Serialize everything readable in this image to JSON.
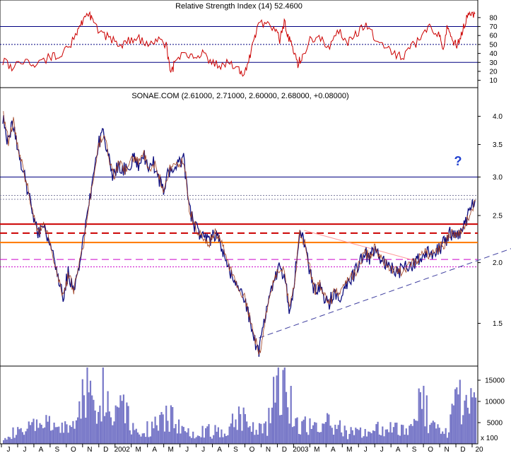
{
  "chart_data": {
    "type": "line",
    "rsi_panel": {
      "title": "Relative Strength Index (14) 52.4600",
      "y_ticks": [
        10,
        20,
        30,
        40,
        50,
        60,
        70,
        80
      ],
      "ylim": [
        5,
        87
      ],
      "levels": {
        "upper": 70,
        "middle": 50,
        "lower": 30
      },
      "line_color": "#cc0000",
      "key_points": [
        {
          "t": 0,
          "v": 32
        },
        {
          "t": 2,
          "v": 25
        },
        {
          "t": 5,
          "v": 34
        },
        {
          "t": 7,
          "v": 28
        },
        {
          "t": 10,
          "v": 35
        },
        {
          "t": 12,
          "v": 38
        },
        {
          "t": 14,
          "v": 45
        },
        {
          "t": 16,
          "v": 58
        },
        {
          "t": 17,
          "v": 72
        },
        {
          "t": 18,
          "v": 80
        },
        {
          "t": 19,
          "v": 86
        },
        {
          "t": 20,
          "v": 72
        },
        {
          "t": 22,
          "v": 62
        },
        {
          "t": 24,
          "v": 55
        },
        {
          "t": 26,
          "v": 50
        },
        {
          "t": 28,
          "v": 54
        },
        {
          "t": 30,
          "v": 56
        },
        {
          "t": 32,
          "v": 50
        },
        {
          "t": 34,
          "v": 56
        },
        {
          "t": 36,
          "v": 48
        },
        {
          "t": 37,
          "v": 15
        },
        {
          "t": 38,
          "v": 32
        },
        {
          "t": 40,
          "v": 40
        },
        {
          "t": 42,
          "v": 35
        },
        {
          "t": 44,
          "v": 42
        },
        {
          "t": 46,
          "v": 30
        },
        {
          "t": 48,
          "v": 26
        },
        {
          "t": 50,
          "v": 30
        },
        {
          "t": 52,
          "v": 22
        },
        {
          "t": 53,
          "v": 15
        },
        {
          "t": 54,
          "v": 30
        },
        {
          "t": 55,
          "v": 48
        },
        {
          "t": 56,
          "v": 70
        },
        {
          "t": 58,
          "v": 75
        },
        {
          "t": 60,
          "v": 68
        },
        {
          "t": 61,
          "v": 55
        },
        {
          "t": 62,
          "v": 75
        },
        {
          "t": 63,
          "v": 58
        },
        {
          "t": 64,
          "v": 45
        },
        {
          "t": 65,
          "v": 28
        },
        {
          "t": 66,
          "v": 38
        },
        {
          "t": 68,
          "v": 58
        },
        {
          "t": 70,
          "v": 55
        },
        {
          "t": 72,
          "v": 48
        },
        {
          "t": 74,
          "v": 65
        },
        {
          "t": 76,
          "v": 52
        },
        {
          "t": 78,
          "v": 62
        },
        {
          "t": 80,
          "v": 72
        },
        {
          "t": 82,
          "v": 58
        },
        {
          "t": 84,
          "v": 50
        },
        {
          "t": 86,
          "v": 40
        },
        {
          "t": 88,
          "v": 35
        },
        {
          "t": 90,
          "v": 48
        },
        {
          "t": 92,
          "v": 55
        },
        {
          "t": 94,
          "v": 70
        },
        {
          "t": 96,
          "v": 60
        },
        {
          "t": 97,
          "v": 48
        },
        {
          "t": 98,
          "v": 72
        },
        {
          "t": 99,
          "v": 55
        },
        {
          "t": 100,
          "v": 48
        },
        {
          "t": 101,
          "v": 60
        },
        {
          "t": 102,
          "v": 78
        },
        {
          "t": 103,
          "v": 86
        },
        {
          "t": 104,
          "v": 84
        }
      ]
    },
    "price_panel": {
      "title": "SONAE.COM (2.61000, 2.71000, 2.60000, 2.68000, +0.08000)",
      "scale": "log",
      "y_ticks": [
        1.5,
        2.0,
        2.5,
        3.0,
        3.5,
        4.0
      ],
      "ylim": [
        1.25,
        4.2
      ],
      "key_points": [
        {
          "t": 0,
          "v": 4.0
        },
        {
          "t": 1,
          "v": 3.55
        },
        {
          "t": 2,
          "v": 3.9
        },
        {
          "t": 3,
          "v": 3.4
        },
        {
          "t": 4,
          "v": 3.1
        },
        {
          "t": 5,
          "v": 2.8
        },
        {
          "t": 6,
          "v": 2.5
        },
        {
          "t": 7,
          "v": 2.3
        },
        {
          "t": 8,
          "v": 2.4
        },
        {
          "t": 9,
          "v": 2.25
        },
        {
          "t": 10,
          "v": 2.05
        },
        {
          "t": 11,
          "v": 1.85
        },
        {
          "t": 12,
          "v": 1.7
        },
        {
          "t": 13,
          "v": 1.9
        },
        {
          "t": 14,
          "v": 1.75
        },
        {
          "t": 15,
          "v": 1.95
        },
        {
          "t": 16,
          "v": 2.2
        },
        {
          "t": 17,
          "v": 2.6
        },
        {
          "t": 18,
          "v": 3.0
        },
        {
          "t": 19,
          "v": 3.5
        },
        {
          "t": 20,
          "v": 3.7
        },
        {
          "t": 21,
          "v": 3.3
        },
        {
          "t": 22,
          "v": 3.0
        },
        {
          "t": 23,
          "v": 3.2
        },
        {
          "t": 24,
          "v": 3.1
        },
        {
          "t": 25,
          "v": 3.15
        },
        {
          "t": 26,
          "v": 3.3
        },
        {
          "t": 27,
          "v": 3.2
        },
        {
          "t": 28,
          "v": 3.35
        },
        {
          "t": 29,
          "v": 3.1
        },
        {
          "t": 30,
          "v": 3.2
        },
        {
          "t": 31,
          "v": 3.0
        },
        {
          "t": 32,
          "v": 2.8
        },
        {
          "t": 33,
          "v": 3.1
        },
        {
          "t": 34,
          "v": 3.15
        },
        {
          "t": 35,
          "v": 3.2
        },
        {
          "t": 36,
          "v": 3.25
        },
        {
          "t": 37,
          "v": 2.6
        },
        {
          "t": 38,
          "v": 2.4
        },
        {
          "t": 39,
          "v": 2.3
        },
        {
          "t": 40,
          "v": 2.25
        },
        {
          "t": 41,
          "v": 2.2
        },
        {
          "t": 42,
          "v": 2.3
        },
        {
          "t": 43,
          "v": 2.25
        },
        {
          "t": 44,
          "v": 2.1
        },
        {
          "t": 45,
          "v": 1.95
        },
        {
          "t": 46,
          "v": 1.85
        },
        {
          "t": 47,
          "v": 1.75
        },
        {
          "t": 48,
          "v": 1.7
        },
        {
          "t": 49,
          "v": 1.55
        },
        {
          "t": 50,
          "v": 1.4
        },
        {
          "t": 51,
          "v": 1.3
        },
        {
          "t": 52,
          "v": 1.5
        },
        {
          "t": 53,
          "v": 1.7
        },
        {
          "t": 54,
          "v": 1.85
        },
        {
          "t": 55,
          "v": 1.95
        },
        {
          "t": 56,
          "v": 1.9
        },
        {
          "t": 57,
          "v": 1.6
        },
        {
          "t": 58,
          "v": 1.8
        },
        {
          "t": 59,
          "v": 2.3
        },
        {
          "t": 60,
          "v": 2.2
        },
        {
          "t": 61,
          "v": 1.95
        },
        {
          "t": 62,
          "v": 1.75
        },
        {
          "t": 63,
          "v": 1.8
        },
        {
          "t": 64,
          "v": 1.7
        },
        {
          "t": 65,
          "v": 1.65
        },
        {
          "t": 66,
          "v": 1.75
        },
        {
          "t": 67,
          "v": 1.7
        },
        {
          "t": 68,
          "v": 1.8
        },
        {
          "t": 69,
          "v": 1.85
        },
        {
          "t": 70,
          "v": 1.9
        },
        {
          "t": 71,
          "v": 2.0
        },
        {
          "t": 72,
          "v": 2.1
        },
        {
          "t": 73,
          "v": 2.05
        },
        {
          "t": 74,
          "v": 2.15
        },
        {
          "t": 75,
          "v": 2.05
        },
        {
          "t": 76,
          "v": 2.0
        },
        {
          "t": 77,
          "v": 1.95
        },
        {
          "t": 78,
          "v": 1.93
        },
        {
          "t": 79,
          "v": 1.92
        },
        {
          "t": 80,
          "v": 1.95
        },
        {
          "t": 81,
          "v": 1.98
        },
        {
          "t": 82,
          "v": 2.0
        },
        {
          "t": 83,
          "v": 2.05
        },
        {
          "t": 84,
          "v": 2.1
        },
        {
          "t": 85,
          "v": 2.08
        },
        {
          "t": 86,
          "v": 2.1
        },
        {
          "t": 87,
          "v": 2.15
        },
        {
          "t": 88,
          "v": 2.2
        },
        {
          "t": 89,
          "v": 2.3
        },
        {
          "t": 90,
          "v": 2.28
        },
        {
          "t": 91,
          "v": 2.3
        },
        {
          "t": 92,
          "v": 2.4
        },
        {
          "t": 93,
          "v": 2.55
        },
        {
          "t": 94,
          "v": 2.68
        }
      ],
      "horizontal_lines": [
        {
          "value": 3.0,
          "color": "#000080",
          "style": "solid"
        },
        {
          "value": 2.75,
          "color": "#8080a0",
          "style": "dotted"
        },
        {
          "value": 2.7,
          "color": "#8080a0",
          "style": "dotted"
        },
        {
          "value": 2.4,
          "color": "#cc0000",
          "style": "solid"
        },
        {
          "value": 2.3,
          "color": "#cc0000",
          "style": "dashed"
        },
        {
          "value": 2.2,
          "color": "#ff7700",
          "style": "solid"
        },
        {
          "value": 2.03,
          "color": "#cc00cc",
          "style": "dashed"
        },
        {
          "value": 1.96,
          "color": "#cc00cc",
          "style": "dotted"
        }
      ],
      "trendlines": [
        {
          "from": {
            "t": 51,
            "v": 1.4
          },
          "to": {
            "t": 103,
            "v": 2.17
          },
          "color": "#4040a0",
          "style": "dashed"
        },
        {
          "from": {
            "t": 60,
            "v": 2.33
          },
          "to": {
            "t": 82,
            "v": 2.02
          },
          "color": "#ff9999",
          "style": "solid"
        }
      ],
      "annotation": "?"
    },
    "volume_panel": {
      "y_ticks": [
        5000,
        10000,
        15000
      ],
      "unit_label": "x 100",
      "ylim": [
        0,
        18000
      ],
      "bar_color": "#7878c8",
      "key_points": [
        {
          "t": 0,
          "v": 2500
        },
        {
          "t": 5,
          "v": 3500
        },
        {
          "t": 8,
          "v": 6000
        },
        {
          "t": 12,
          "v": 4000
        },
        {
          "t": 16,
          "v": 5500
        },
        {
          "t": 18,
          "v": 18000
        },
        {
          "t": 20,
          "v": 9000
        },
        {
          "t": 22,
          "v": 16000
        },
        {
          "t": 24,
          "v": 6000
        },
        {
          "t": 26,
          "v": 18000
        },
        {
          "t": 28,
          "v": 5000
        },
        {
          "t": 30,
          "v": 3500
        },
        {
          "t": 34,
          "v": 5000
        },
        {
          "t": 37,
          "v": 8000
        },
        {
          "t": 40,
          "v": 3000
        },
        {
          "t": 44,
          "v": 4000
        },
        {
          "t": 48,
          "v": 3000
        },
        {
          "t": 50,
          "v": 6000
        },
        {
          "t": 52,
          "v": 8000
        },
        {
          "t": 55,
          "v": 5000
        },
        {
          "t": 58,
          "v": 4000
        },
        {
          "t": 60,
          "v": 18000
        },
        {
          "t": 62,
          "v": 18000
        },
        {
          "t": 64,
          "v": 6000
        },
        {
          "t": 68,
          "v": 5000
        },
        {
          "t": 72,
          "v": 5500
        },
        {
          "t": 76,
          "v": 3000
        },
        {
          "t": 80,
          "v": 3500
        },
        {
          "t": 84,
          "v": 4500
        },
        {
          "t": 88,
          "v": 3500
        },
        {
          "t": 90,
          "v": 6000
        },
        {
          "t": 92,
          "v": 15000
        },
        {
          "t": 94,
          "v": 5000
        },
        {
          "t": 98,
          "v": 4000
        },
        {
          "t": 100,
          "v": 12000
        },
        {
          "t": 104,
          "v": 9500
        }
      ]
    },
    "x_axis": {
      "labels": [
        "J",
        "J",
        "A",
        "S",
        "O",
        "N",
        "D",
        "2002",
        "M",
        "A",
        "M",
        "J",
        "J",
        "A",
        "S",
        "O",
        "N",
        "D",
        "2003",
        "M",
        "A",
        "M",
        "J",
        "J",
        "A",
        "S",
        "O",
        "N",
        "D",
        "20"
      ]
    }
  }
}
